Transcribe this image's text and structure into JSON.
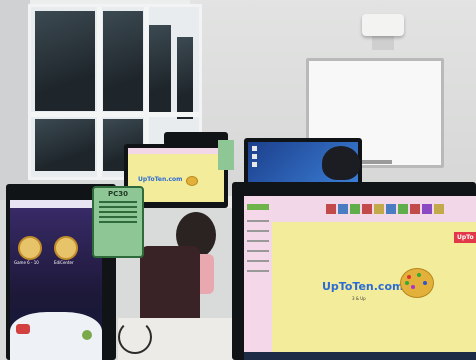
{
  "scene": {
    "main_screen_site_name": "UpToTen.com",
    "main_screen_small_text": "3 & Up",
    "left_screen_caption_1": "Game 6 - 10",
    "left_screen_caption_2": "EdiCenter",
    "main_screen_corner_badge": "UpTo",
    "center_screen_site_name": "UpToTen.com",
    "tag_card_title": "PC30"
  },
  "colors": {
    "screen_background": "#f3ec9b",
    "toolbar_pink": "#f1d7e7",
    "tag_card_green": "#8fc696",
    "desktop_blue": "#1c3f8c"
  }
}
